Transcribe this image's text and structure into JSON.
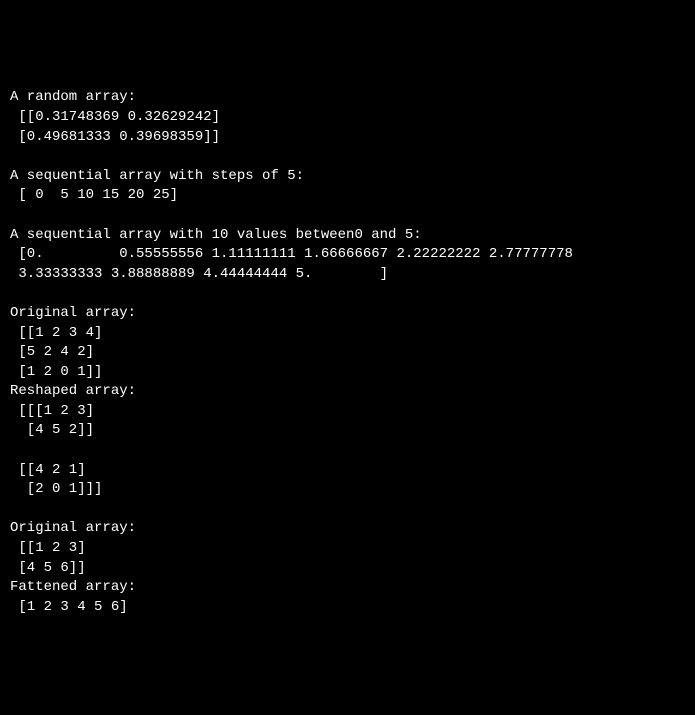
{
  "output": {
    "line1": "A random array:",
    "line2": " [[0.31748369 0.32629242]",
    "line3": " [0.49681333 0.39698359]]",
    "line4": "",
    "line5": "A sequential array with steps of 5:",
    "line6": " [ 0  5 10 15 20 25]",
    "line7": "",
    "line8": "A sequential array with 10 values between0 and 5:",
    "line9": " [0.         0.55555556 1.11111111 1.66666667 2.22222222 2.77777778",
    "line10": " 3.33333333 3.88888889 4.44444444 5.        ]",
    "line11": "",
    "line12": "Original array:",
    "line13": " [[1 2 3 4]",
    "line14": " [5 2 4 2]",
    "line15": " [1 2 0 1]]",
    "line16": "Reshaped array:",
    "line17": " [[[1 2 3]",
    "line18": "  [4 5 2]]",
    "line19": "",
    "line20": " [[4 2 1]",
    "line21": "  [2 0 1]]]",
    "line22": "",
    "line23": "Original array:",
    "line24": " [[1 2 3]",
    "line25": " [4 5 6]]",
    "line26": "Fattened array:",
    "line27": " [1 2 3 4 5 6]"
  }
}
